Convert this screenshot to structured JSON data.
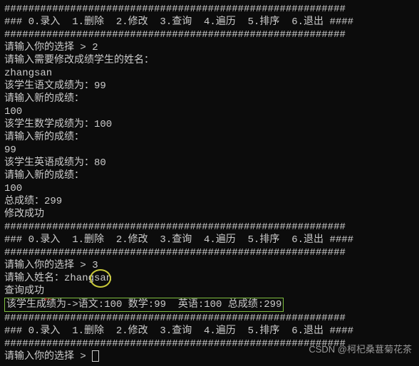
{
  "hashline": "#########################################################",
  "menu": "### 0.录入  1.删除  2.修改  3.查询  4.遍历  5.排序  6.退出 ####",
  "session1": {
    "prompt_choice": "请输入你的选择 > ",
    "choice": "2",
    "prompt_name": "请输入需要修改成绩学生的姓名：",
    "name": "zhangsan",
    "chinese_label": "该学生语文成绩为：",
    "chinese_score": "99",
    "new_prompt": "请输入新的成绩：",
    "chinese_new": "100",
    "math_label": "该学生数学成绩为：",
    "math_score": "100",
    "math_new": "99",
    "english_label": "该学生英语成绩为：",
    "english_score": "80",
    "english_new": "100",
    "total_label": "总成绩：",
    "total": "299",
    "success": "修改成功"
  },
  "session2": {
    "prompt_choice": "请输入你的选择 > ",
    "choice": "3",
    "prompt_name": "请输入姓名：",
    "name": "zhangsan",
    "success": "查询成功",
    "result": "该学生成绩为->语文:100 数学:99  英语:100 总成绩:299"
  },
  "session3": {
    "prompt_choice": "请输入你的选择 > "
  },
  "watermark": "CSDN @柯杞桑葚菊花茶"
}
